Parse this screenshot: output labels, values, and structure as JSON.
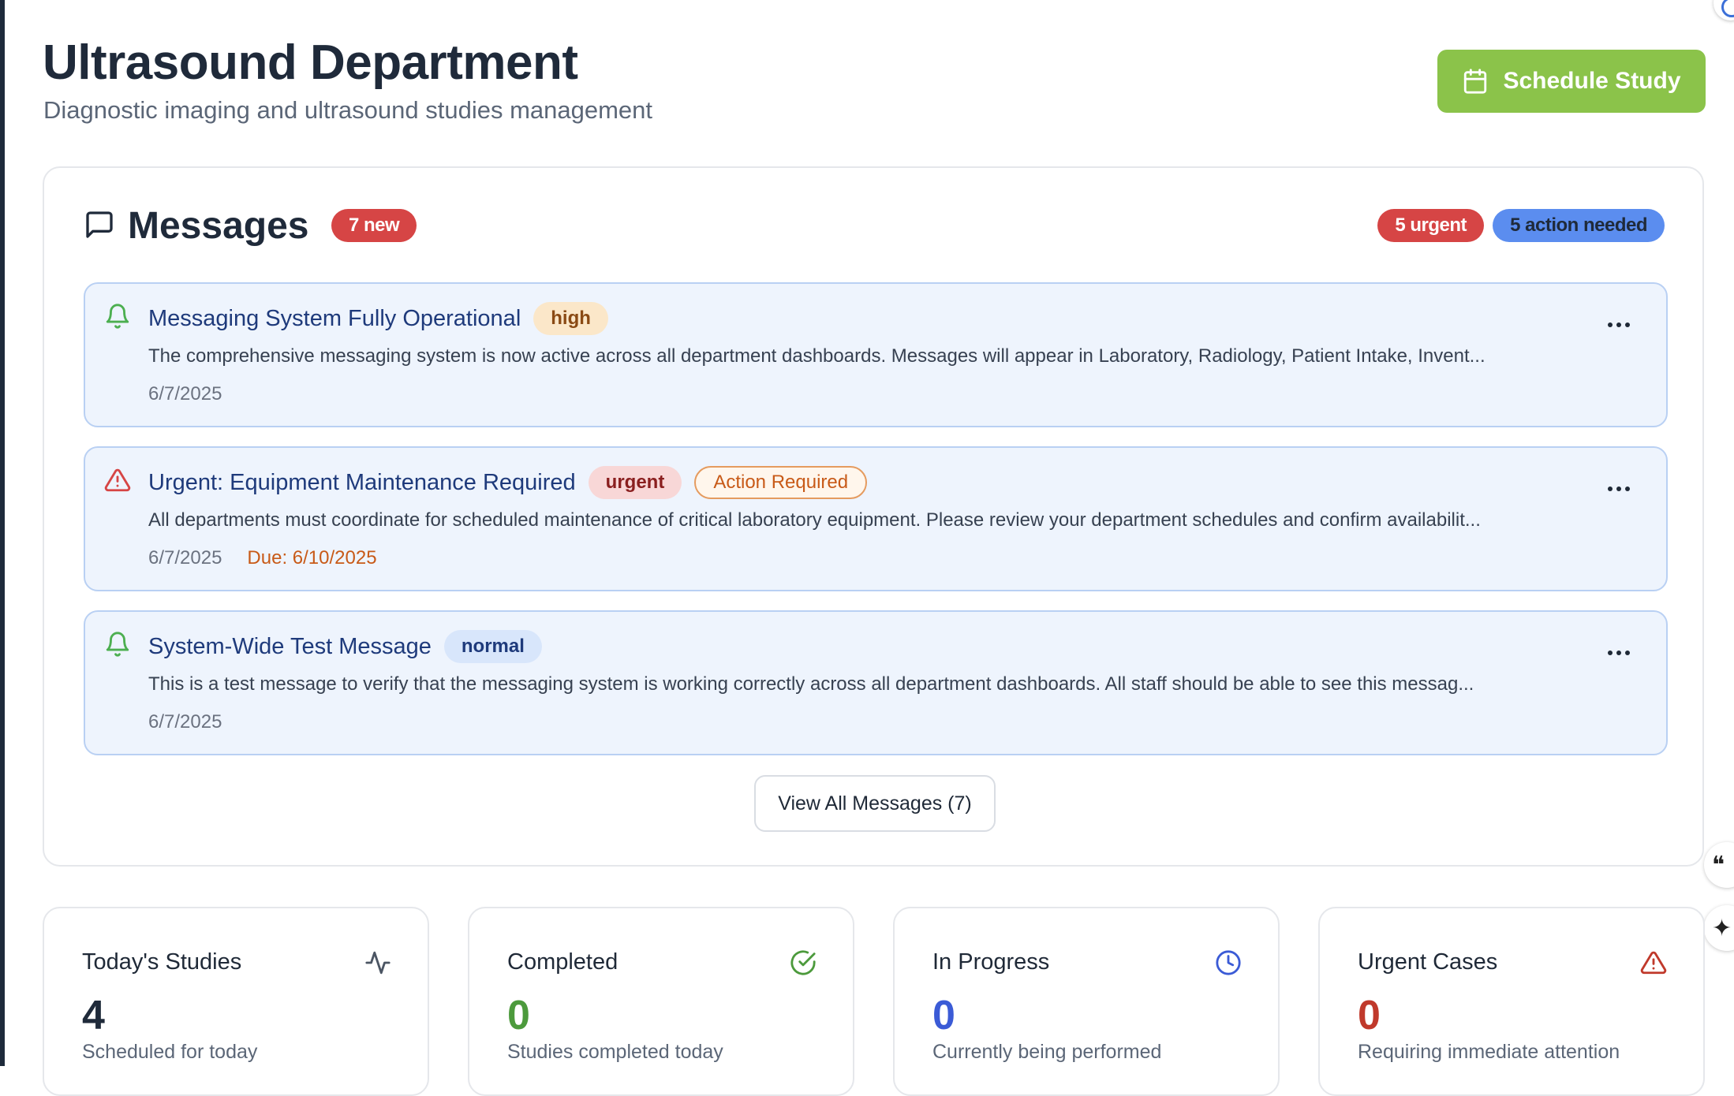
{
  "header": {
    "title": "Ultrasound Department",
    "subtitle": "Diagnostic imaging and ultrasound studies management",
    "schedule_label": "Schedule Study",
    "accent_color": "#8bc34a"
  },
  "messages": {
    "title": "Messages",
    "new_badge": "7 new",
    "urgent_badge": "5 urgent",
    "action_badge": "5 action needed",
    "items": [
      {
        "icon": "bell-icon",
        "title": "Messaging System Fully Operational",
        "priority": "high",
        "body": "The comprehensive messaging system is now active across all department dashboards. Messages will appear in Laboratory, Radiology, Patient Intake, Invent...",
        "date": "6/7/2025"
      },
      {
        "icon": "alert-triangle-icon",
        "title": "Urgent: Equipment Maintenance Required",
        "priority": "urgent",
        "action_tag": "Action Required",
        "body": "All departments must coordinate for scheduled maintenance of critical laboratory equipment. Please review your department schedules and confirm availabilit...",
        "date": "6/7/2025",
        "due": "Due: 6/10/2025"
      },
      {
        "icon": "bell-icon",
        "title": "System-Wide Test Message",
        "priority": "normal",
        "body": "This is a test message to verify that the messaging system is working correctly across all department dashboards. All staff should be able to see this messag...",
        "date": "6/7/2025"
      }
    ],
    "view_all_label": "View All Messages (7)"
  },
  "stats": [
    {
      "label": "Today's Studies",
      "value": "4",
      "desc": "Scheduled for today",
      "icon": "activity-icon",
      "color": "#1f2a3a"
    },
    {
      "label": "Completed",
      "value": "0",
      "desc": "Studies completed today",
      "icon": "check-circle-icon",
      "color": "#4c9a3c"
    },
    {
      "label": "In Progress",
      "value": "0",
      "desc": "Currently being performed",
      "icon": "clock-icon",
      "color": "#3b5bd6"
    },
    {
      "label": "Urgent Cases",
      "value": "0",
      "desc": "Requiring immediate attention",
      "icon": "alert-triangle-icon",
      "color": "#c0392b"
    }
  ]
}
